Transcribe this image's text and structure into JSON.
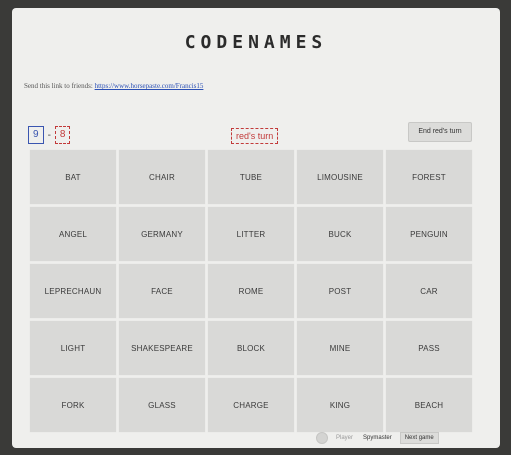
{
  "header": {
    "title": "CODENAMES"
  },
  "share": {
    "text": "Send this link to friends: ",
    "link": "https://www.horsepaste.com/Francis15"
  },
  "score": {
    "blue": "9",
    "dash": "-",
    "red": "8"
  },
  "turn": {
    "label": "red's turn"
  },
  "controls": {
    "end_turn_label": "End red's turn",
    "player_label": "Player",
    "spymaster_label": "Spymaster",
    "next_game_label": "Next game"
  },
  "cards": [
    "BAT",
    "CHAIR",
    "TUBE",
    "LIMOUSINE",
    "FOREST",
    "ANGEL",
    "GERMANY",
    "LITTER",
    "BUCK",
    "PENGUIN",
    "LEPRECHAUN",
    "FACE",
    "ROME",
    "POST",
    "CAR",
    "LIGHT",
    "SHAKESPEARE",
    "BLOCK",
    "MINE",
    "PASS",
    "FORK",
    "GLASS",
    "CHARGE",
    "KING",
    "BEACH"
  ],
  "colors": {
    "blue_team": "#3a55b0",
    "red_team": "#c23a3a",
    "card_bg": "#d9d9d7"
  }
}
